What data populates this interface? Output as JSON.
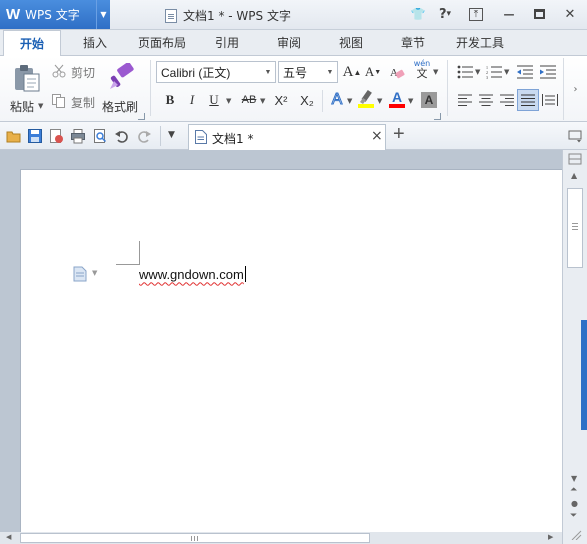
{
  "app": {
    "logo": "W",
    "name": "WPS 文字",
    "menu_arrow": "▼",
    "window_title": "文档1 * - WPS 文字"
  },
  "window_controls": {
    "skin": "👕",
    "help": "?",
    "help_arrow": "▾",
    "pin": "⤒",
    "minimize": "—",
    "maximize": "☐",
    "close": "✕"
  },
  "tabs": [
    {
      "label": "开始",
      "active": true
    },
    {
      "label": "插入",
      "active": false
    },
    {
      "label": "页面布局",
      "active": false
    },
    {
      "label": "引用",
      "active": false
    },
    {
      "label": "审阅",
      "active": false
    },
    {
      "label": "视图",
      "active": false
    },
    {
      "label": "章节",
      "active": false
    },
    {
      "label": "开发工具",
      "active": false
    }
  ],
  "clipboard": {
    "paste": "粘贴",
    "cut": "剪切",
    "copy": "复制",
    "format_painter": "格式刷"
  },
  "font": {
    "family": "Calibri (正文)",
    "size": "五号",
    "grow": "A",
    "shrink": "A",
    "bold": "B",
    "italic": "I",
    "underline": "U",
    "strike": "AB",
    "superscript": "X²",
    "subscript": "X₂",
    "phonetic_top": "wén",
    "phonetic_bottom": "文"
  },
  "colors": {
    "accent": "#2f6fc6",
    "highlight_swatch": "#ffff00",
    "font_color_swatch": "#ff0000",
    "spell_underline": "#e03030"
  },
  "quick_access": {
    "more_arrow": "▼",
    "add_tab": "+"
  },
  "document_tab": {
    "title": "文档1 *",
    "close": "×"
  },
  "document": {
    "text": "www.gndown.com"
  }
}
